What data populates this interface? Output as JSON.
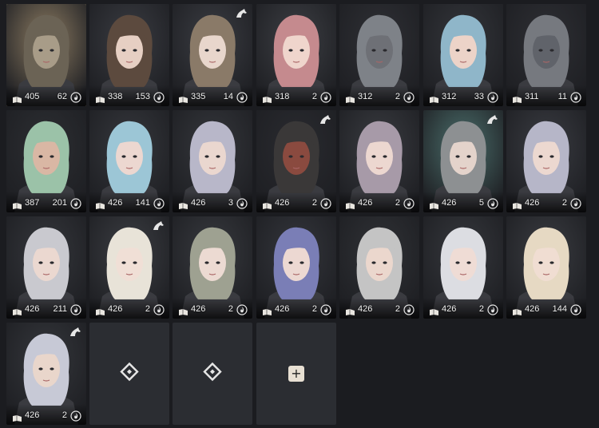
{
  "characters": [
    {
      "level": "405",
      "energy": "62",
      "bg": "#8d7c62",
      "hair": "#6b6355",
      "skin": "#a89c88",
      "selected": true,
      "seal": false
    },
    {
      "level": "338",
      "energy": "153",
      "bg": "#3a3c42",
      "hair": "#5c4a3e",
      "skin": "#e6cfc3",
      "selected": false,
      "seal": false
    },
    {
      "level": "335",
      "energy": "14",
      "bg": "#3b3d43",
      "hair": "#8a7a68",
      "skin": "#e8d6cc",
      "selected": false,
      "seal": true
    },
    {
      "level": "318",
      "energy": "2",
      "bg": "#3d3f44",
      "hair": "#c58a8e",
      "skin": "#efd5cc",
      "selected": false,
      "seal": false
    },
    {
      "level": "312",
      "energy": "2",
      "bg": "#2f3035",
      "hair": "#7e8288",
      "skin": "#6e7076",
      "selected": false,
      "seal": false
    },
    {
      "level": "312",
      "energy": "33",
      "bg": "#34363b",
      "hair": "#8fb6c9",
      "skin": "#ecd3c8",
      "selected": false,
      "seal": false
    },
    {
      "level": "311",
      "energy": "11",
      "bg": "#2e2f34",
      "hair": "#76797f",
      "skin": "#60636a",
      "selected": false,
      "seal": false
    },
    {
      "level": "387",
      "energy": "201",
      "bg": "#2d2f33",
      "hair": "#9bc2a8",
      "skin": "#d9b7a4",
      "selected": false,
      "seal": false
    },
    {
      "level": "426",
      "energy": "141",
      "bg": "#36383d",
      "hair": "#9cc6d6",
      "skin": "#ecd7d0",
      "selected": false,
      "seal": false
    },
    {
      "level": "426",
      "energy": "3",
      "bg": "#35373c",
      "hair": "#b8b7c9",
      "skin": "#ead7cf",
      "selected": false,
      "seal": false
    },
    {
      "level": "426",
      "energy": "2",
      "bg": "#2a2b30",
      "hair": "#3a3838",
      "skin": "#8a4a3f",
      "selected": false,
      "seal": true
    },
    {
      "level": "426",
      "energy": "2",
      "bg": "#3a3c41",
      "hair": "#a79aa8",
      "skin": "#ecd7d0",
      "selected": false,
      "seal": false
    },
    {
      "level": "426",
      "energy": "5",
      "bg": "#4b6f6c",
      "hair": "#8d9092",
      "skin": "#e4d3cb",
      "selected": false,
      "seal": true
    },
    {
      "level": "426",
      "energy": "2",
      "bg": "#3a3c42",
      "hair": "#b6b6c8",
      "skin": "#ecd8d0",
      "selected": false,
      "seal": false
    },
    {
      "level": "426",
      "energy": "211",
      "bg": "#35373c",
      "hair": "#c9c9cf",
      "skin": "#ebd8d0",
      "selected": false,
      "seal": false
    },
    {
      "level": "426",
      "energy": "2",
      "bg": "#3c3e43",
      "hair": "#e8e3d8",
      "skin": "#f0dfd6",
      "selected": false,
      "seal": true
    },
    {
      "level": "426",
      "energy": "2",
      "bg": "#383a3f",
      "hair": "#9ea191",
      "skin": "#ecdad2",
      "selected": false,
      "seal": false
    },
    {
      "level": "426",
      "energy": "2",
      "bg": "#34363c",
      "hair": "#7a7eb6",
      "skin": "#ecd8d2",
      "selected": false,
      "seal": false
    },
    {
      "level": "426",
      "energy": "2",
      "bg": "#303236",
      "hair": "#c4c4c4",
      "skin": "#ebd7cd",
      "selected": false,
      "seal": false
    },
    {
      "level": "426",
      "energy": "2",
      "bg": "#36383d",
      "hair": "#dcdde2",
      "skin": "#efdcd5",
      "selected": false,
      "seal": false
    },
    {
      "level": "426",
      "energy": "144",
      "bg": "#3a3c41",
      "hair": "#e6d9c3",
      "skin": "#f0ddd2",
      "selected": false,
      "seal": false
    },
    {
      "level": "426",
      "energy": "2",
      "bg": "#35373c",
      "hair": "#c7c9d6",
      "skin": "#e9d6cb",
      "selected": false,
      "seal": true
    }
  ],
  "empty_slots": [
    {
      "type": "locked",
      "icon": "slot-diamond-icon"
    },
    {
      "type": "locked",
      "icon": "slot-diamond-icon"
    },
    {
      "type": "add",
      "label": "+",
      "icon": "plus-icon"
    }
  ]
}
